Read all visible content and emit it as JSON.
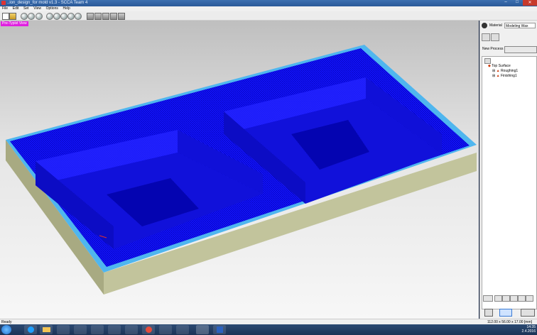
{
  "window": {
    "title": "..ion_design_for mold v1.3 - SCCA Team 4",
    "min_label": "–",
    "max_label": "□",
    "close_label": "✕"
  },
  "menu": [
    "File",
    "Edit",
    "Set",
    "View",
    "Options",
    "Help"
  ],
  "toolbar_icons": [
    "new-icon",
    "open-icon",
    "save-icon",
    "refresh-icon",
    "move-icon",
    "zoom-icon",
    "zoom-window-icon",
    "fit-icon",
    "cube-iso-icon",
    "cube-front-icon",
    "cube-top-icon",
    "cube-side-icon",
    "cube-shaded-icon"
  ],
  "viewport": {
    "label": "Pre-Typist View",
    "colors": {
      "toolpath": "#1a1aff",
      "stock_top": "#52b8f0",
      "stock_side": "#b7b991",
      "background": "#e6e6e6"
    }
  },
  "right_panel": {
    "material_label": "Material",
    "material_value": "Modeling Wax",
    "new_process_label": "New Process",
    "tree": {
      "root": "Top Surface",
      "children": [
        "Roughing1",
        "Finishing1"
      ]
    }
  },
  "status": {
    "left": "Ready",
    "dimensions": "112.00 x 56.00 x 17.00 [mm]"
  },
  "taskbar": {
    "time": "14:35",
    "date": "2.4.2016",
    "colors": {
      "start": "#2f8de8",
      "ie": "#1fa0ff",
      "explorer": "#f2c455",
      "word": "#2b62c0",
      "chrome": "#e54b3b"
    }
  }
}
